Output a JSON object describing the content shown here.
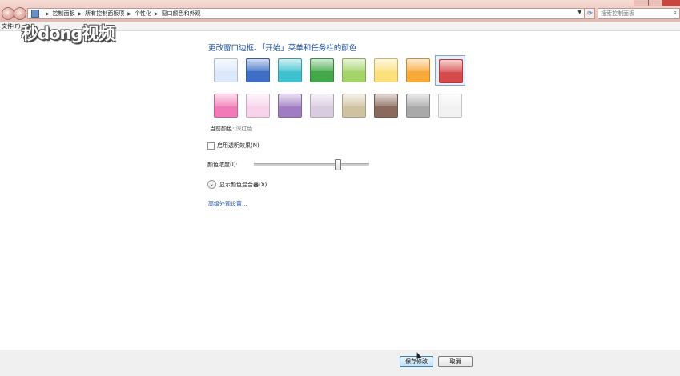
{
  "address": {
    "crumbs": [
      "控制面板",
      "所有控制面板项",
      "个性化",
      "窗口颜色和外观"
    ],
    "search_placeholder": "搜索控制面板"
  },
  "menu": {
    "file": "文件(F)"
  },
  "watermark": "秒dong视频",
  "main": {
    "heading": "更改窗口边框、「开始」菜单和任务栏的颜色",
    "current_color_label": "当前颜色:",
    "current_color_value": "深红色",
    "transparency_label": "启用透明效果(N)",
    "transparency_checked": false,
    "intensity_label": "颜色浓度(I):",
    "intensity_value": 0.72,
    "mixer_label": "显示颜色混合器(X)",
    "advanced_link": "高级外观设置..."
  },
  "swatches": [
    {
      "color": "#dce9fb",
      "selected": false
    },
    {
      "color": "#3f6fc5",
      "selected": false
    },
    {
      "color": "#3fc1cf",
      "selected": false
    },
    {
      "color": "#42a84a",
      "selected": false
    },
    {
      "color": "#a4d36a",
      "selected": false
    },
    {
      "color": "#fbe07c",
      "selected": false
    },
    {
      "color": "#f7a93a",
      "selected": false
    },
    {
      "color": "#d54a4a",
      "selected": true
    },
    {
      "color": "#f27ab8",
      "selected": false
    },
    {
      "color": "#f7d4ec",
      "selected": false
    },
    {
      "color": "#a07cc3",
      "selected": false
    },
    {
      "color": "#d9cce0",
      "selected": false
    },
    {
      "color": "#cfc2a0",
      "selected": false
    },
    {
      "color": "#8a6a5c",
      "selected": false
    },
    {
      "color": "#a9a9a9",
      "selected": false
    },
    {
      "color": "#f2f2f2",
      "selected": false
    }
  ],
  "buttons": {
    "save": "保存修改",
    "cancel": "取消"
  }
}
